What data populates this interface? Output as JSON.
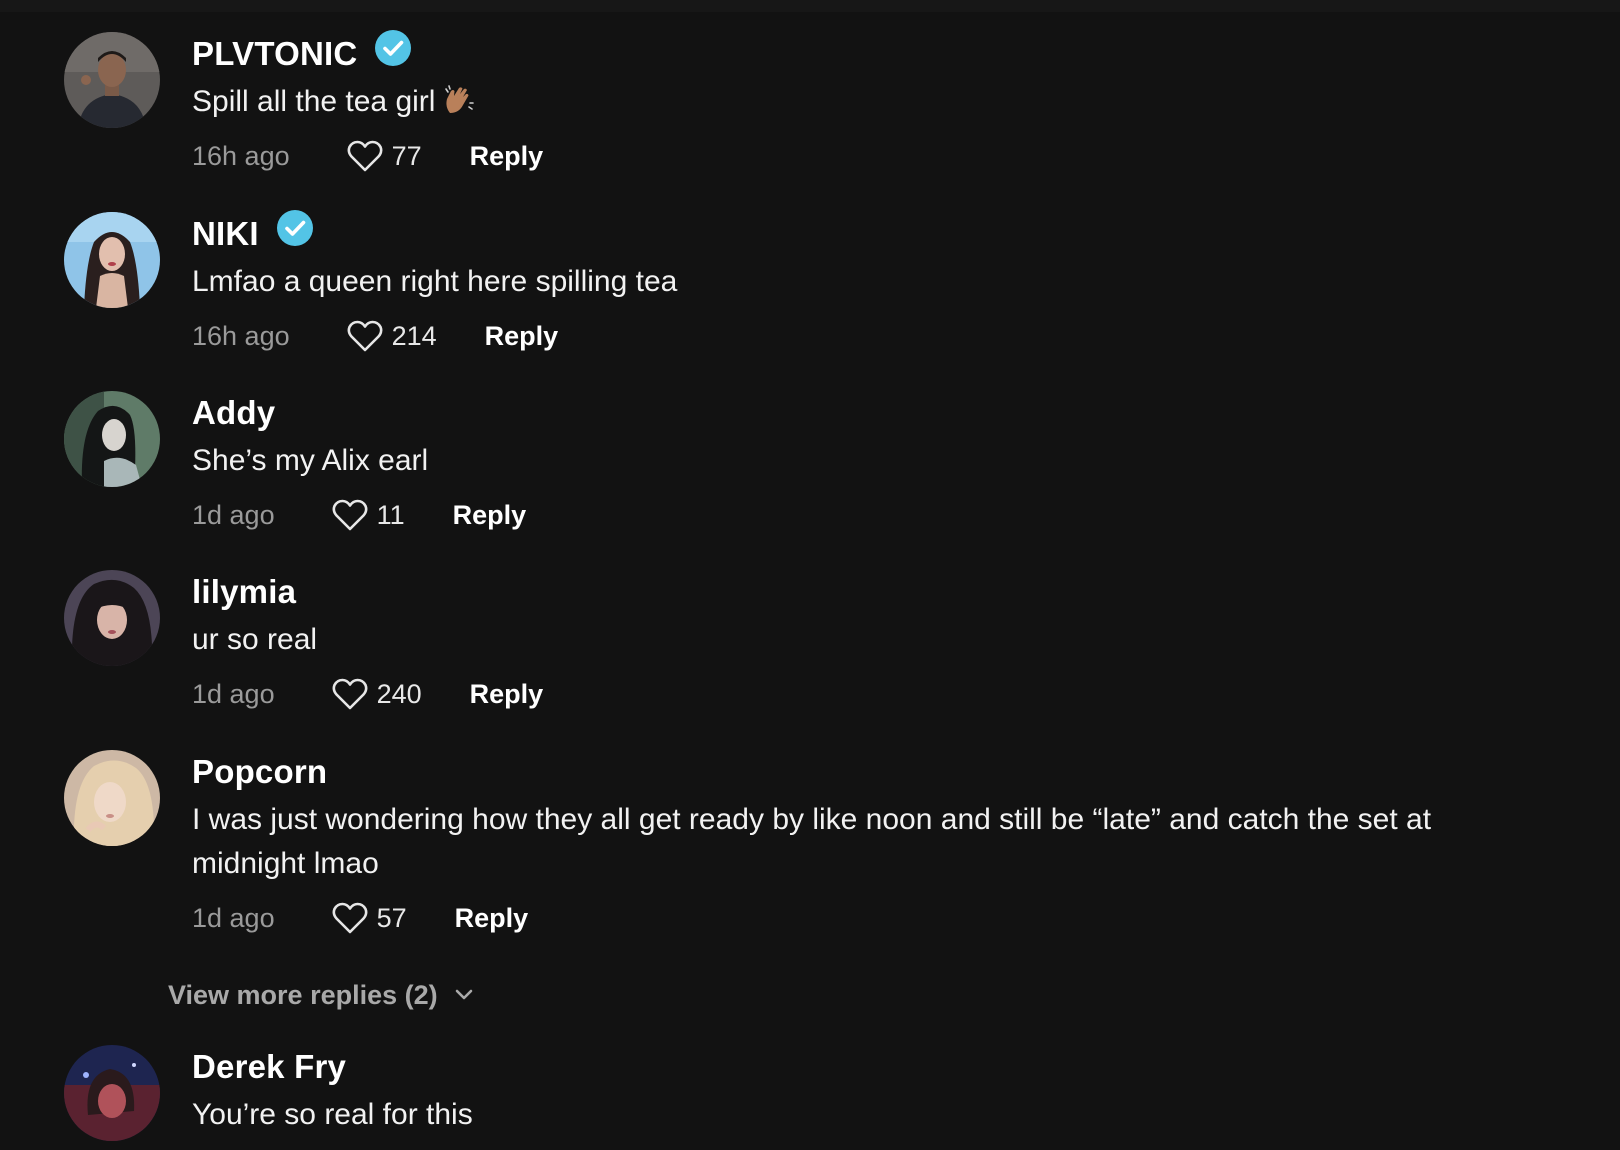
{
  "comments": [
    {
      "username": "PLVTONIC",
      "verified": true,
      "text": "Spill all the tea girl",
      "emoji": "clapping-hands-emoji",
      "time": "16h ago",
      "likes": "77",
      "reply_label": "Reply",
      "avatar_colors": [
        "#5d5a58",
        "#2a2c33"
      ]
    },
    {
      "username": "NIKI",
      "verified": true,
      "text": "Lmfao a queen right here spilling tea",
      "time": "16h ago",
      "likes": "214",
      "reply_label": "Reply",
      "avatar_colors": [
        "#8ec3e6",
        "#2b2424"
      ]
    },
    {
      "username": "Addy",
      "verified": false,
      "text": "She’s my Alix earl",
      "time": "1d ago",
      "likes": "11",
      "reply_label": "Reply",
      "avatar_colors": [
        "#6e8a76",
        "#1c1f1f"
      ]
    },
    {
      "username": "lilymia",
      "verified": false,
      "text": "ur so real",
      "time": "1d ago",
      "likes": "240",
      "reply_label": "Reply",
      "avatar_colors": [
        "#5b5266",
        "#1d1a22"
      ]
    },
    {
      "username": "Popcorn",
      "verified": false,
      "text": "I was just wondering how they all get ready by like noon and still be “late” and catch the set at midnight lmao",
      "time": "1d ago",
      "likes": "57",
      "reply_label": "Reply",
      "avatar_colors": [
        "#d8c2ad",
        "#9c8878"
      ]
    },
    {
      "username": "Derek Fry",
      "verified": false,
      "text": "You’re so real for this",
      "avatar_colors": [
        "#6a2d36",
        "#1e2a55"
      ]
    }
  ],
  "view_more_replies": "View more replies (2)",
  "colors": {
    "background": "#121212",
    "verified_badge": "#53c4e6",
    "secondary_text": "#9a9a9a"
  }
}
